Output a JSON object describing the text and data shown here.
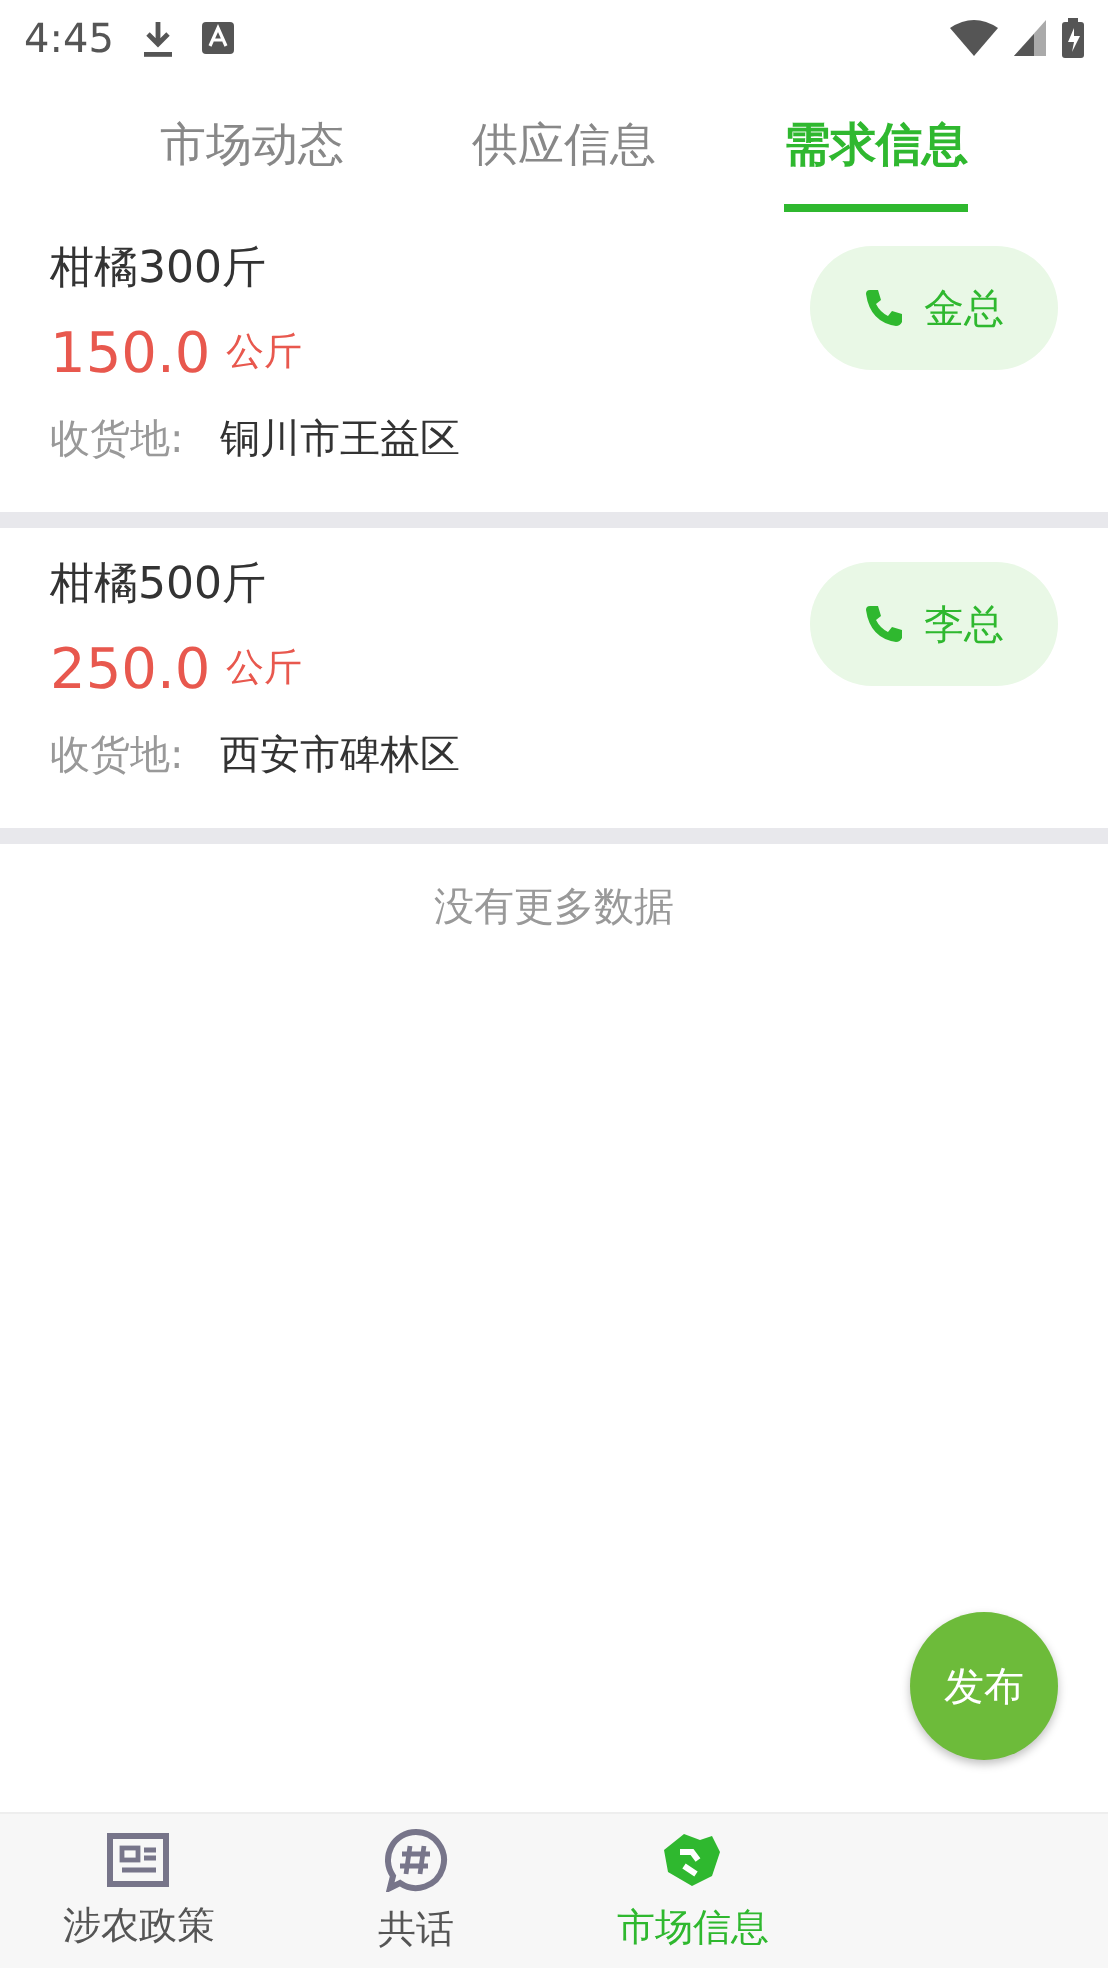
{
  "status_bar": {
    "time": "4:45"
  },
  "tabs": [
    {
      "label": "市场动态",
      "selected": false
    },
    {
      "label": "供应信息",
      "selected": false
    },
    {
      "label": "需求信息",
      "selected": true
    }
  ],
  "listings": [
    {
      "title": "柑橘300斤",
      "price": "150.0",
      "unit": "公斤",
      "address_label": "收货地:",
      "address": "铜川市王益区",
      "contact": "金总"
    },
    {
      "title": "柑橘500斤",
      "price": "250.0",
      "unit": "公斤",
      "address_label": "收货地:",
      "address": "西安市碑林区",
      "contact": "李总"
    }
  ],
  "end_note": "没有更多数据",
  "fab": {
    "label": "发布"
  },
  "bottom_nav": [
    {
      "label": "涉农政策",
      "kind": "news",
      "selected": false
    },
    {
      "label": "共话",
      "kind": "chat",
      "selected": false
    },
    {
      "label": "市场信息",
      "kind": "market",
      "selected": true
    }
  ]
}
